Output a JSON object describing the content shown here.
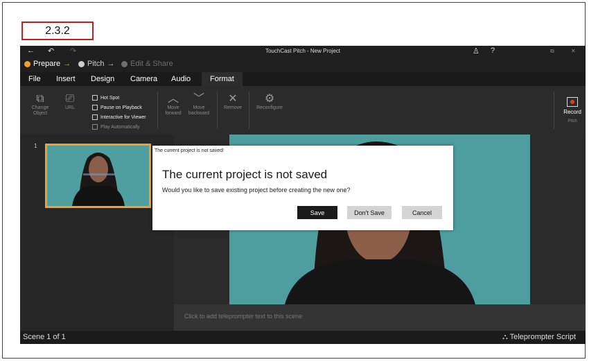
{
  "step_label": "2.3.2",
  "window": {
    "title": "TouchCast Pitch - New Project",
    "back_glyph": "←",
    "undo_glyph": "↶",
    "redo_glyph": "↷",
    "user_glyph": "♙",
    "help_glyph": "?",
    "restore_glyph": "⧉",
    "close_glyph": "✕"
  },
  "workflow": {
    "steps": [
      {
        "label": "Prepare",
        "arrow": "→",
        "color": "#f0a030"
      },
      {
        "label": "Pitch",
        "arrow": "→",
        "color": "#cfcfcf"
      },
      {
        "label": "Edit & Share",
        "arrow": "",
        "color": "#6f6f6f"
      }
    ]
  },
  "menu": [
    "File",
    "Insert",
    "Design",
    "Camera",
    "Audio",
    "Format"
  ],
  "ribbon": {
    "change_object": "Change Object",
    "url": "URL",
    "checkboxes": [
      "Hot Spot",
      "Pause on Playback",
      "Interactive for Viewer",
      "Play Automatically"
    ],
    "move_forward": "Move forward",
    "move_backward": "Move backward",
    "remove": "Remove",
    "reconfigure": "Reconfigure",
    "record": "Record",
    "group_label": "Pitch"
  },
  "sidebar": {
    "scene_number": "1"
  },
  "dialog": {
    "caption": "The current project is not saved!",
    "title": "The current project is not saved",
    "message": "Would you like to save existing project before creating the new one?",
    "save": "Save",
    "dont_save": "Don't Save",
    "cancel": "Cancel"
  },
  "teleprompter_placeholder": "Click to add teleprompter text to this scene",
  "status": {
    "scene": "Scene 1 of 1",
    "teleprompter_script": "Teleprompter Script",
    "teleprompter_icon": "⛬"
  }
}
